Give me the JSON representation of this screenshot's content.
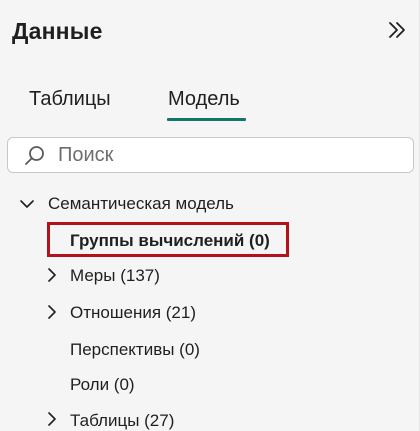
{
  "pane": {
    "title": "Данные",
    "collapse_icon": "double-chevron-right-icon"
  },
  "tabs": [
    {
      "label": "Таблицы",
      "selected": false
    },
    {
      "label": "Модель",
      "selected": true
    }
  ],
  "accent_color": "#117865",
  "highlight_color": "#b3121a",
  "search": {
    "placeholder": "Поиск",
    "value": ""
  },
  "tree": {
    "root": {
      "label": "Семантическая модель",
      "expanded": true
    },
    "items": [
      {
        "label": "Группы вычислений (0)",
        "expandable": false,
        "highlighted": true
      },
      {
        "label": "Меры (137)",
        "expandable": true
      },
      {
        "label": "Отношения (21)",
        "expandable": true
      },
      {
        "label": "Перспективы (0)",
        "expandable": false
      },
      {
        "label": "Роли (0)",
        "expandable": false
      },
      {
        "label": "Таблицы (27)",
        "expandable": true
      }
    ]
  }
}
